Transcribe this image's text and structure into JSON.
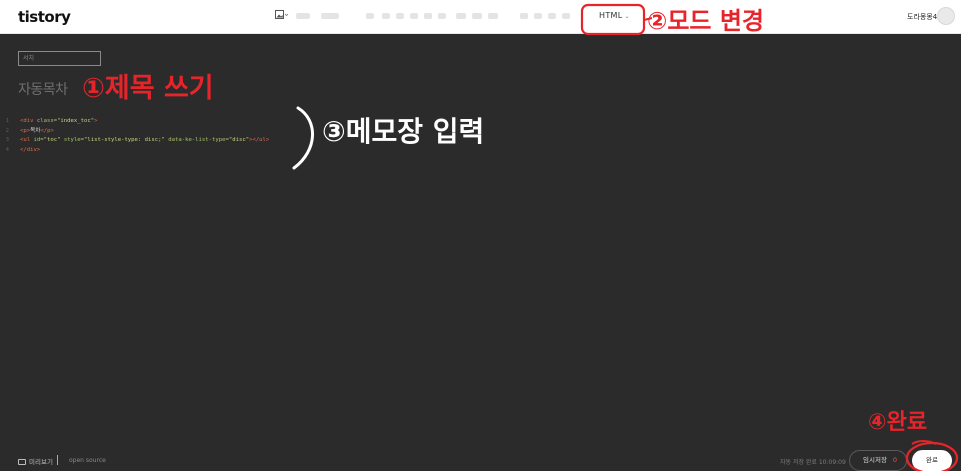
{
  "header": {
    "logo": "tistory",
    "mode_label": "HTML",
    "user_name": "도라몽몽4"
  },
  "editor": {
    "search_placeholder": "서치",
    "title": "자동목차",
    "code_lines": [
      {
        "num": "1",
        "parts": [
          [
            "tag",
            "<div "
          ],
          [
            "attr",
            "class="
          ],
          [
            "str",
            "\"index_toc\""
          ],
          [
            "tag",
            ">"
          ]
        ]
      },
      {
        "num": "2",
        "parts": [
          [
            "tag",
            "<p>"
          ],
          [
            "txt",
            "목차"
          ],
          [
            "tag",
            "</p>"
          ]
        ]
      },
      {
        "num": "3",
        "parts": [
          [
            "tag",
            "<ul "
          ],
          [
            "attr",
            "id="
          ],
          [
            "str",
            "\"toc\" "
          ],
          [
            "attr",
            "style="
          ],
          [
            "str",
            "\"list-style-type: disc;\" "
          ],
          [
            "attr",
            "data-ke-list-type="
          ],
          [
            "str",
            "\"disc\""
          ],
          [
            "tag",
            "></ul>"
          ]
        ]
      },
      {
        "num": "4",
        "parts": [
          [
            "tag",
            "</div>"
          ]
        ]
      }
    ]
  },
  "footer": {
    "preview_label": "미리보기",
    "open_source_label": "open source",
    "autosave_text": "자동 저장 완료 10:09:09",
    "draft_label": "임시저장",
    "draft_count": "0",
    "publish_label": "완료"
  },
  "annotations": {
    "step1": "①제목 쓰기",
    "step2": "②모드 변경",
    "step3": "③메모장 입력",
    "step4": "④완료"
  },
  "colors": {
    "annotation": "#e8242b",
    "editor_bg": "#2b2b2b",
    "tag": "#e06c4b",
    "attr": "#a6c265",
    "string": "#c9d67a"
  }
}
